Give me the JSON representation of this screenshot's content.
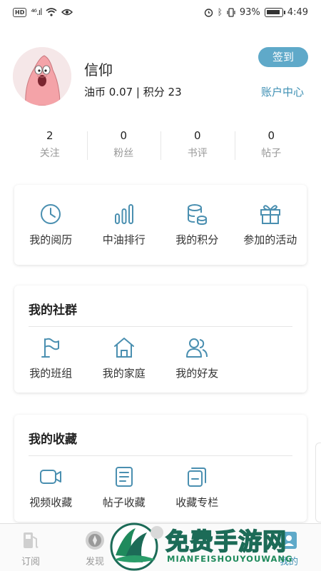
{
  "status_bar": {
    "hd_label": "HD",
    "signal": "⁴⁶.ıl",
    "battery": "93%",
    "time": "4:49"
  },
  "profile": {
    "username": "信仰",
    "coins_line": "油币 0.07 | 积分 23",
    "signin_label": "签到",
    "account_label": "账户中心"
  },
  "stats": [
    {
      "value": "2",
      "label": "关注"
    },
    {
      "value": "0",
      "label": "粉丝"
    },
    {
      "value": "0",
      "label": "书评"
    },
    {
      "value": "0",
      "label": "帖子"
    }
  ],
  "quick_menu": [
    {
      "label": "我的阅历",
      "icon": "clock-icon"
    },
    {
      "label": "中油排行",
      "icon": "ranking-bars-icon"
    },
    {
      "label": "我的积分",
      "icon": "coins-stack-icon"
    },
    {
      "label": "参加的活动",
      "icon": "gift-icon"
    }
  ],
  "community": {
    "title": "我的社群",
    "items": [
      {
        "label": "我的班组",
        "icon": "flag-icon"
      },
      {
        "label": "我的家庭",
        "icon": "house-icon"
      },
      {
        "label": "我的好友",
        "icon": "friends-icon"
      }
    ]
  },
  "favorites": {
    "title": "我的收藏",
    "items": [
      {
        "label": "视频收藏",
        "icon": "video-icon"
      },
      {
        "label": "帖子收藏",
        "icon": "document-icon"
      },
      {
        "label": "收藏专栏",
        "icon": "column-pages-icon"
      }
    ]
  },
  "bottom_nav": [
    {
      "label": "订阅",
      "icon": "fuel-pump-icon"
    },
    {
      "label": "发现",
      "icon": "compass-icon"
    },
    {
      "label": "我的",
      "icon": "profile-icon",
      "active": true
    }
  ],
  "watermark": {
    "text": "免费手游网",
    "sub": "MIANFEISHOUYOUWANG"
  },
  "colors": {
    "accent": "#3d8fb3",
    "button": "#5fa9c9",
    "icon": "#4a8fb0"
  }
}
